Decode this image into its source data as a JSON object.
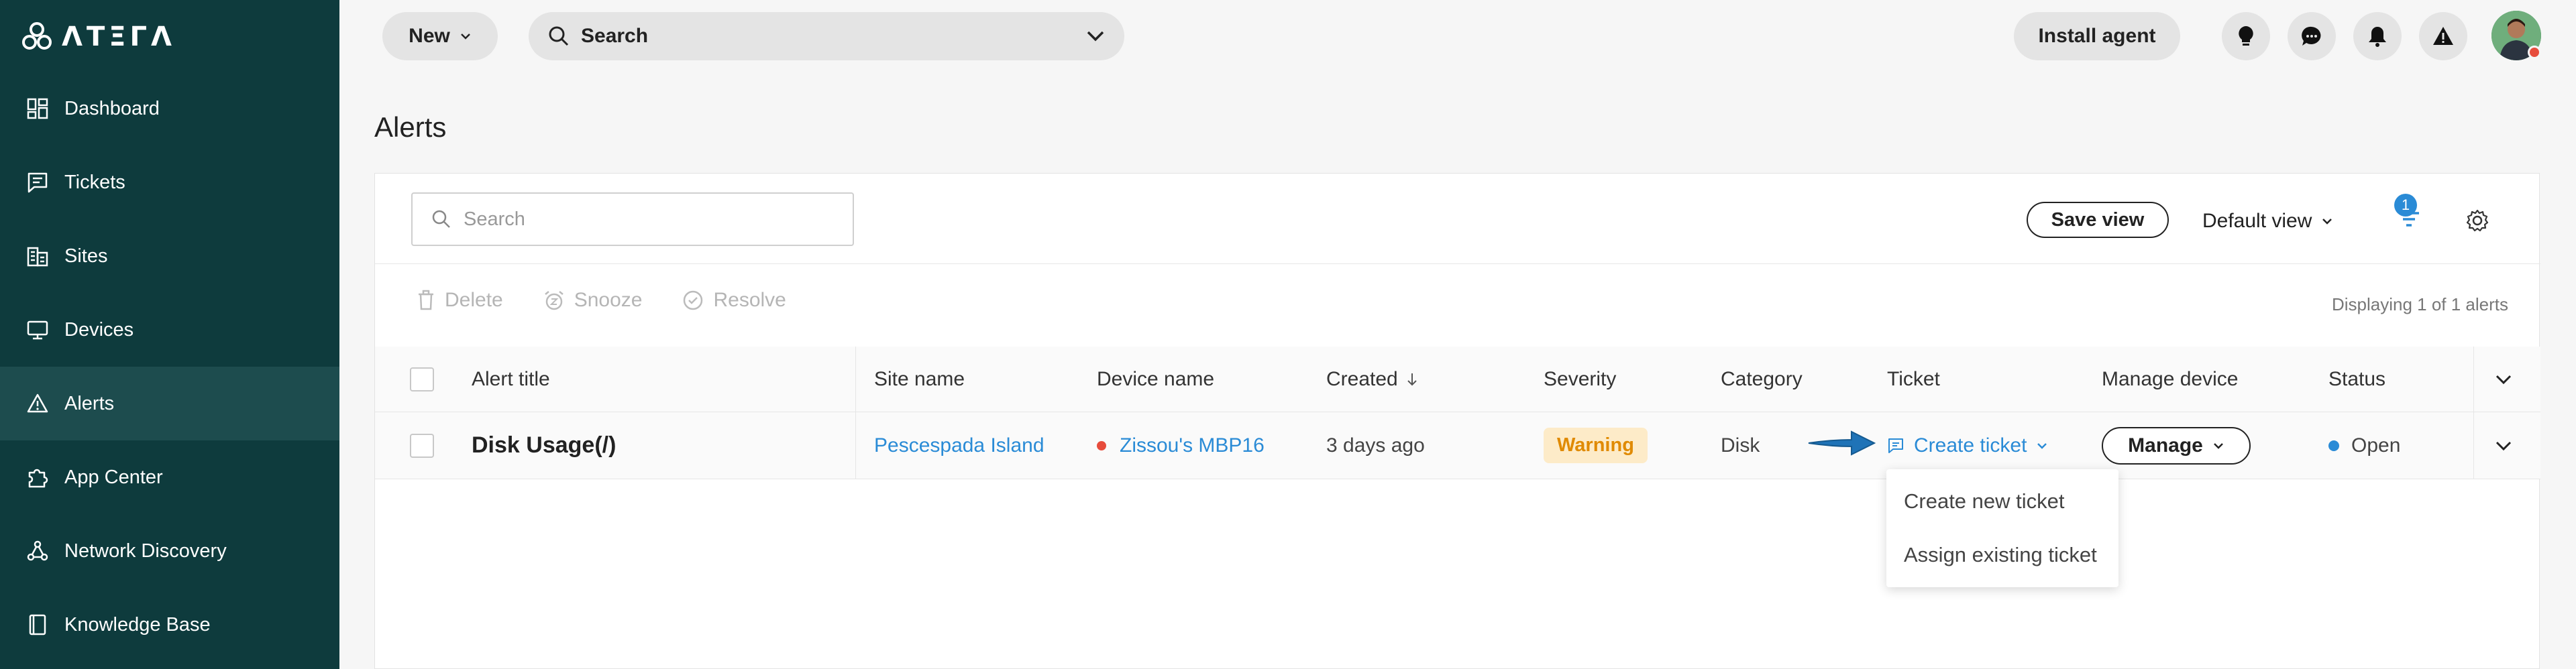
{
  "app": {
    "logo_text": "ΛΤΞΓΛ"
  },
  "sidebar": {
    "items": [
      {
        "label": "Dashboard",
        "icon": "dashboard-icon"
      },
      {
        "label": "Tickets",
        "icon": "tickets-icon"
      },
      {
        "label": "Sites",
        "icon": "sites-icon"
      },
      {
        "label": "Devices",
        "icon": "devices-icon"
      },
      {
        "label": "Alerts",
        "icon": "alert-icon",
        "active": true
      },
      {
        "label": "App Center",
        "icon": "puzzle-icon"
      },
      {
        "label": "Network Discovery",
        "icon": "network-icon"
      },
      {
        "label": "Knowledge Base",
        "icon": "book-icon"
      }
    ]
  },
  "topbar": {
    "new_label": "New",
    "search_label": "Search",
    "install_agent_label": "Install agent",
    "icons": [
      "lightbulb-icon",
      "chat-icon",
      "bell-icon",
      "warning-icon"
    ]
  },
  "page": {
    "title": "Alerts"
  },
  "toolbar": {
    "search_placeholder": "Search",
    "save_view_label": "Save view",
    "default_view_label": "Default view",
    "filter_count": "1"
  },
  "actions": {
    "delete": "Delete",
    "snooze": "Snooze",
    "resolve": "Resolve",
    "display_count": "Displaying 1 of 1 alerts"
  },
  "table": {
    "headers": {
      "alert_title": "Alert title",
      "site_name": "Site name",
      "device_name": "Device name",
      "created": "Created",
      "severity": "Severity",
      "category": "Category",
      "ticket": "Ticket",
      "manage_device": "Manage device",
      "status": "Status"
    },
    "rows": [
      {
        "alert_title": "Disk Usage(/)",
        "site_name": "Pescespada Island",
        "device_name": "Zissou's MBP16",
        "created": "3 days ago",
        "severity": "Warning",
        "category": "Disk",
        "ticket": "Create ticket",
        "manage": "Manage",
        "status": "Open"
      }
    ]
  },
  "ticket_dropdown": {
    "items": [
      "Create new ticket",
      "Assign existing ticket"
    ]
  },
  "colors": {
    "sidebar_bg": "#0e3b3d",
    "link": "#2a8bd6",
    "warning_text": "#e08a00",
    "warning_bg": "#fdebc8",
    "device_offline": "#e74c3c"
  }
}
